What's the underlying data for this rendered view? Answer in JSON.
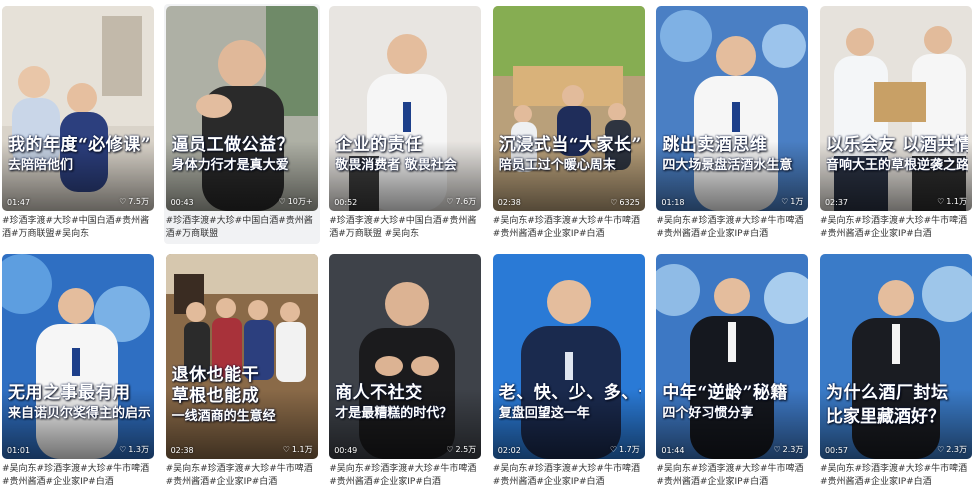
{
  "cards": [
    {
      "cap1": "我的年度“必修课”",
      "cap2": "去陪陪他们",
      "duration": "01:47",
      "likes": "7.5万",
      "tags": "#珍酒李渡#大珍#中国白酒#贵州酱酒#万商联盟#吴向东",
      "colors": {
        "bg1": "#dcd6cc",
        "bg2": "#c9c2b6",
        "accent": "#2b3e7a"
      }
    },
    {
      "cap1": "逼员工做公益？",
      "cap2": "身体力行才是真大爱",
      "duration": "00:43",
      "likes": "10万+",
      "tags": "#珍酒李渡#大珍#中国白酒#贵州酱酒#万商联盟",
      "colors": {
        "bg1": "#b7b8ad",
        "bg2": "#6f7d6a",
        "accent": "#2a2a2a"
      }
    },
    {
      "cap1": "企业的责任",
      "cap2": "敬畏消费者 敬畏社会",
      "duration": "00:52",
      "likes": "7.6万",
      "tags": "#珍酒李渡#大珍#中国白酒#贵州酱酒#万商联盟 #吴向东",
      "colors": {
        "bg1": "#ece9e6",
        "bg2": "#cfc9c2",
        "accent": "#f4f4f4"
      }
    },
    {
      "cap1": "沉浸式当“大家长”",
      "cap2": "陪员工过个暖心周末",
      "duration": "02:38",
      "likes": "6325",
      "tags": "#吴向东#珍酒李渡#大珍#牛市啤酒#贵州酱酒#企业家IP#白酒",
      "colors": {
        "bg1": "#8fb45a",
        "bg2": "#c99a5a",
        "accent": "#1f2d5a"
      }
    },
    {
      "cap1": "跳出卖酒思维",
      "cap2": "四大场景盘活酒水生意",
      "duration": "01:18",
      "likes": "1万",
      "tags": "#吴向东#珍酒李渡#大珍#牛市啤酒#贵州酱酒#企业家IP#白酒",
      "colors": {
        "bg1": "#3a6db8",
        "bg2": "#7fa9d8",
        "accent": "#f5f5f5"
      }
    },
    {
      "cap1": "以乐会友 以酒共情",
      "cap2": "音响大王的草根逆袭之路",
      "duration": "02:37",
      "likes": "1.1万",
      "tags": "#吴向东#珍酒李渡#大珍#牛市啤酒#贵州酱酒#企业家IP#白酒",
      "colors": {
        "bg1": "#e8e4de",
        "bg2": "#c8c0b4",
        "accent": "#c8a066"
      }
    },
    {
      "cap1": "无用之事最有用",
      "cap2": "来自诺贝尔奖得主的启示",
      "duration": "01:01",
      "likes": "1.3万",
      "tags": "#吴向东#珍酒李渡#大珍#牛市啤酒#贵州酱酒#企业家IP#白酒",
      "colors": {
        "bg1": "#2f6fc2",
        "bg2": "#6aa4e0",
        "accent": "#f5f5f5"
      }
    },
    {
      "cap1": "退休也能干",
      "cap2": "草根也能成",
      "cap3": "一线酒商的生意经",
      "duration": "02:38",
      "likes": "1.1万",
      "tags": "#吴向东#珍酒李渡#大珍#牛市啤酒#贵州酱酒#企业家IP#白酒",
      "colors": {
        "bg1": "#d8cbb6",
        "bg2": "#7a5b3a",
        "accent": "#a8323a"
      }
    },
    {
      "cap1": "商人不社交",
      "cap2": "才是最糟糕的时代？",
      "duration": "00:49",
      "likes": "2.5万",
      "tags": "#吴向东#珍酒李渡#大珍#牛市啤酒#贵州酱酒#企业家IP#白酒",
      "colors": {
        "bg1": "#4a4e55",
        "bg2": "#2a2d33",
        "accent": "#1b1b1d"
      }
    },
    {
      "cap1": "老、快、少、多、长",
      "cap2": "复盘回望这一年",
      "duration": "02:02",
      "likes": "1.7万",
      "tags": "#吴向东#珍酒李渡#大珍#牛市啤酒#贵州酱酒#企业家IP#白酒",
      "colors": {
        "bg1": "#2a7ad6",
        "bg2": "#1d55a8",
        "accent": "#1a2a4e"
      }
    },
    {
      "cap1": "中年“逆龄”秘籍",
      "cap2": "四个好习惯分享",
      "duration": "01:44",
      "likes": "2.3万",
      "tags": "#吴向东#珍酒李渡#大珍#牛市啤酒#贵州酱酒#企业家IP#白酒",
      "colors": {
        "bg1": "#3d78c4",
        "bg2": "#9cc1e6",
        "accent": "#15181f"
      }
    },
    {
      "cap1": "为什么酒厂封坛",
      "cap2": "比家里藏酒好？",
      "duration": "00:57",
      "likes": "2.3万",
      "tags": "#吴向东#珍酒李渡#大珍#牛市啤酒#贵州酱酒#企业家IP#白酒",
      "colors": {
        "bg1": "#3a7bc8",
        "bg2": "#8fb8e2",
        "accent": "#1a1c22"
      }
    }
  ]
}
